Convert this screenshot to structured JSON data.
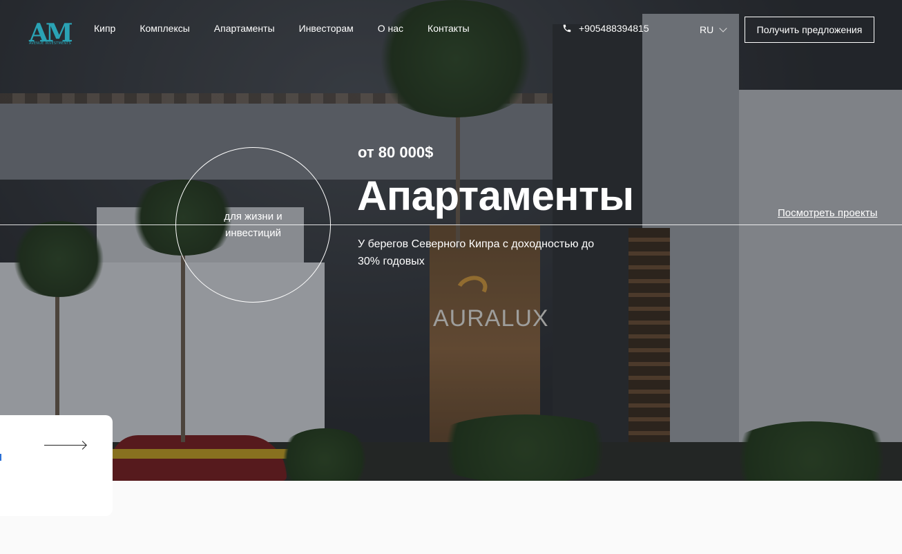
{
  "header": {
    "logo_mark": "AM",
    "logo_tagline": "AVENUE INVESTMENTS",
    "nav": [
      "Кипр",
      "Комплексы",
      "Апартаменты",
      "Инвесторам",
      "О нас",
      "Контакты"
    ],
    "phone": "+905488394815",
    "language": "RU",
    "cta_label": "Получить предложения"
  },
  "hero": {
    "price": "от 80 000$",
    "title": "Апартаменты",
    "circle_text": "для жизни и инвестиций",
    "description": "У берегов Северного Кипра с доходностью до 30% годовых",
    "view_projects_label": "Посмотреть проекты",
    "sign_text": "AURALUX"
  },
  "colors": {
    "accent": "#2aa3b5",
    "text": "#ffffff",
    "background": "#fafafa"
  }
}
